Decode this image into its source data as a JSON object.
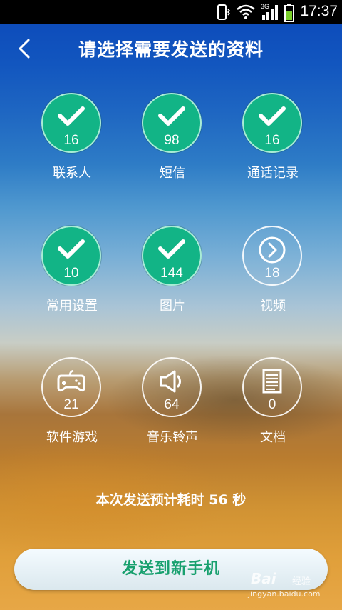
{
  "status_bar": {
    "time": "17:37",
    "network": "3G",
    "icons": [
      "vibrate-icon",
      "wifi-icon",
      "signal-icon",
      "battery-icon"
    ]
  },
  "header": {
    "back_icon": "chevron-left-icon",
    "title": "请选择需要发送的资料"
  },
  "items": [
    {
      "label": "联系人",
      "count": "16",
      "selected": true,
      "icon": "check-icon"
    },
    {
      "label": "短信",
      "count": "98",
      "selected": true,
      "icon": "check-icon"
    },
    {
      "label": "通话记录",
      "count": "16",
      "selected": true,
      "icon": "check-icon"
    },
    {
      "label": "常用设置",
      "count": "10",
      "selected": true,
      "icon": "check-icon"
    },
    {
      "label": "图片",
      "count": "144",
      "selected": true,
      "icon": "check-icon"
    },
    {
      "label": "视频",
      "count": "18",
      "selected": false,
      "icon": "play-circle-icon"
    },
    {
      "label": "软件游戏",
      "count": "21",
      "selected": false,
      "icon": "gamepad-icon"
    },
    {
      "label": "音乐铃声",
      "count": "64",
      "selected": false,
      "icon": "speaker-icon"
    },
    {
      "label": "文档",
      "count": "0",
      "selected": false,
      "icon": "document-icon"
    }
  ],
  "estimate_text": "本次发送预计耗时 56 秒",
  "send_button": {
    "label": "发送到新手机"
  },
  "watermark": {
    "brand": "Bai",
    "sub": "经验",
    "url": "jingyan.baidu.com"
  },
  "colors": {
    "selected": "#12b486",
    "button_text": "#18a06e",
    "header_blue": "#0b47b8"
  }
}
